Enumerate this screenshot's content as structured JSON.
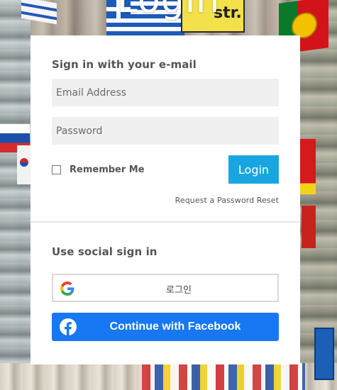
{
  "page": {
    "title": "Login"
  },
  "background": {
    "street_sign_text": "str."
  },
  "email_section": {
    "heading": "Sign in with your e-mail",
    "email_placeholder": "Email Address",
    "password_placeholder": "Password",
    "remember_label": "Remember Me",
    "remember_checked": false,
    "login_label": "Login",
    "reset_label": "Request a Password Reset"
  },
  "social_section": {
    "heading": "Use social sign in",
    "google_label": "로그인",
    "google_icon": "google-icon",
    "facebook_label": "Continue with Facebook",
    "facebook_icon": "facebook-icon"
  },
  "colors": {
    "login_button": "#19a6e0",
    "facebook_button": "#1877f2",
    "input_background": "#f0f0f0",
    "card_background": "#ffffff"
  }
}
